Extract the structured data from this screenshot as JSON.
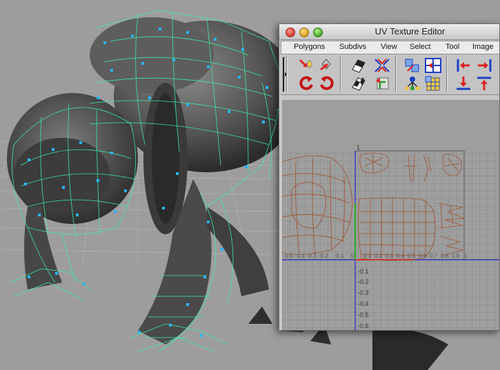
{
  "window": {
    "title": "UV Texture Editor"
  },
  "menu": [
    "Polygons",
    "Subdivs",
    "View",
    "Select",
    "Tool",
    "Image"
  ],
  "toolbar": {
    "icons": [
      "move-uv-icon",
      "flip-u-icon",
      "flip-v-icon",
      "rotate-ccw-icon",
      "rotate-cw-icon",
      "checker-map-icon",
      "checker-map-2-icon",
      "sew-uv-icon",
      "cut-uv-icon",
      "move-sew-icon",
      "layout-uv-icon",
      "grid-icon",
      "uv-shell-icon",
      "align-left-icon",
      "align-right-icon",
      "align-bottom-icon",
      "align-top-icon"
    ]
  },
  "uv_grid": {
    "axis_labels_vertical": [
      "1",
      "-0.1",
      "-0.2",
      "-0.3",
      "-0.4",
      "-0.5",
      "-0.6"
    ],
    "axis_labels_horizontal": [
      "-0.5",
      "-0.4",
      "-0.3",
      "-0.2",
      "-0.1",
      "0",
      "0.1",
      "0.2",
      "0.3",
      "0.4",
      "0.5",
      "0.6",
      "0.7",
      "0.8",
      "0.9",
      "1"
    ],
    "colors": {
      "wire": "#a0522d",
      "u_axis": "#d42a2a",
      "v_axis": "#2222cc",
      "grid": "#6e6e6e"
    }
  },
  "scene": {
    "wire_color": "#39f0a8",
    "vertex_color": "#28b6ff",
    "mesh_color": "#4a4a4a"
  }
}
